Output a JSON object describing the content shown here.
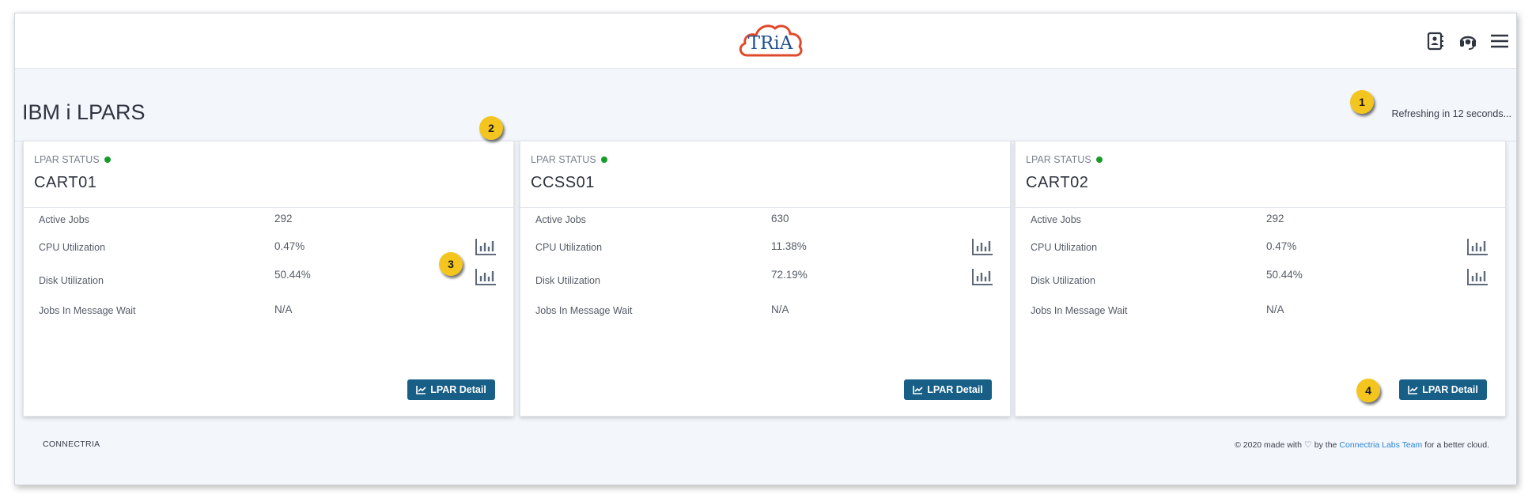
{
  "header": {
    "logo_text": "TRiA",
    "icons": [
      "contacts-icon",
      "headset-support-icon",
      "hamburger-menu-icon"
    ]
  },
  "page": {
    "title": "IBM i LPARS",
    "refresh_text": "Refreshing in 12 seconds..."
  },
  "callouts": [
    "1",
    "2",
    "3",
    "4"
  ],
  "cards": [
    {
      "status_label": "LPAR STATUS",
      "status_color": "#1a9a2c",
      "name": "CART01",
      "metrics": [
        {
          "label": "Active Jobs",
          "value": "292"
        },
        {
          "label": "CPU Utilization",
          "value": "0.47%"
        },
        {
          "label": "Disk Utilization",
          "value": "50.44%"
        },
        {
          "label": "Jobs In Message Wait",
          "value": "N/A"
        }
      ],
      "detail_button": "LPAR Detail"
    },
    {
      "status_label": "LPAR STATUS",
      "status_color": "#1a9a2c",
      "name": "CCSS01",
      "metrics": [
        {
          "label": "Active Jobs",
          "value": "630"
        },
        {
          "label": "CPU Utilization",
          "value": "11.38%"
        },
        {
          "label": "Disk Utilization",
          "value": "72.19%"
        },
        {
          "label": "Jobs In Message Wait",
          "value": "N/A"
        }
      ],
      "detail_button": "LPAR Detail"
    },
    {
      "status_label": "LPAR STATUS",
      "status_color": "#1a9a2c",
      "name": "CART02",
      "metrics": [
        {
          "label": "Active Jobs",
          "value": "292"
        },
        {
          "label": "CPU Utilization",
          "value": "0.47%"
        },
        {
          "label": "Disk Utilization",
          "value": "50.44%"
        },
        {
          "label": "Jobs In Message Wait",
          "value": "N/A"
        }
      ],
      "detail_button": "LPAR Detail"
    }
  ],
  "footer": {
    "left": "CONNECTRIA",
    "right_prefix": "© 2020 made with",
    "right_mid": "by the",
    "right_link": "Connectria Labs Team",
    "right_suffix": "for a better cloud."
  },
  "colors": {
    "accent": "#175f86",
    "callout": "#f4c51f",
    "status_ok": "#1a9a2c",
    "link": "#2a86d6"
  }
}
